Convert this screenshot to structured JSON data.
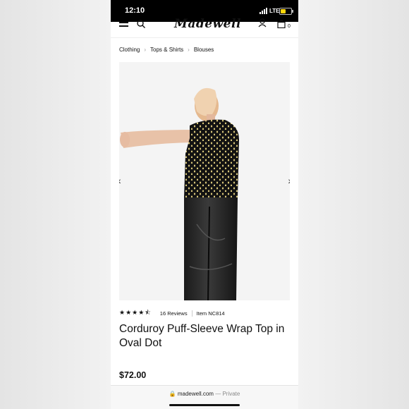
{
  "status_bar": {
    "time": "12:10",
    "network": "LTE"
  },
  "header": {
    "logo": "Madewell",
    "cart_count": "0"
  },
  "breadcrumb": [
    "Clothing",
    "Tops & Shirts",
    "Blouses"
  ],
  "product": {
    "rating": 4.5,
    "stars": "★★★★⯪",
    "reviews": "16 Reviews",
    "item_number": "Item NC814",
    "title": "Corduroy Puff-Sleeve Wrap Top in Oval Dot",
    "price": "$72.00"
  },
  "browser": {
    "domain": "madewell.com",
    "privacy": "— Private"
  },
  "colors": {
    "text": "#111111",
    "status_bg": "#000000",
    "battery": "#ffd60a"
  }
}
